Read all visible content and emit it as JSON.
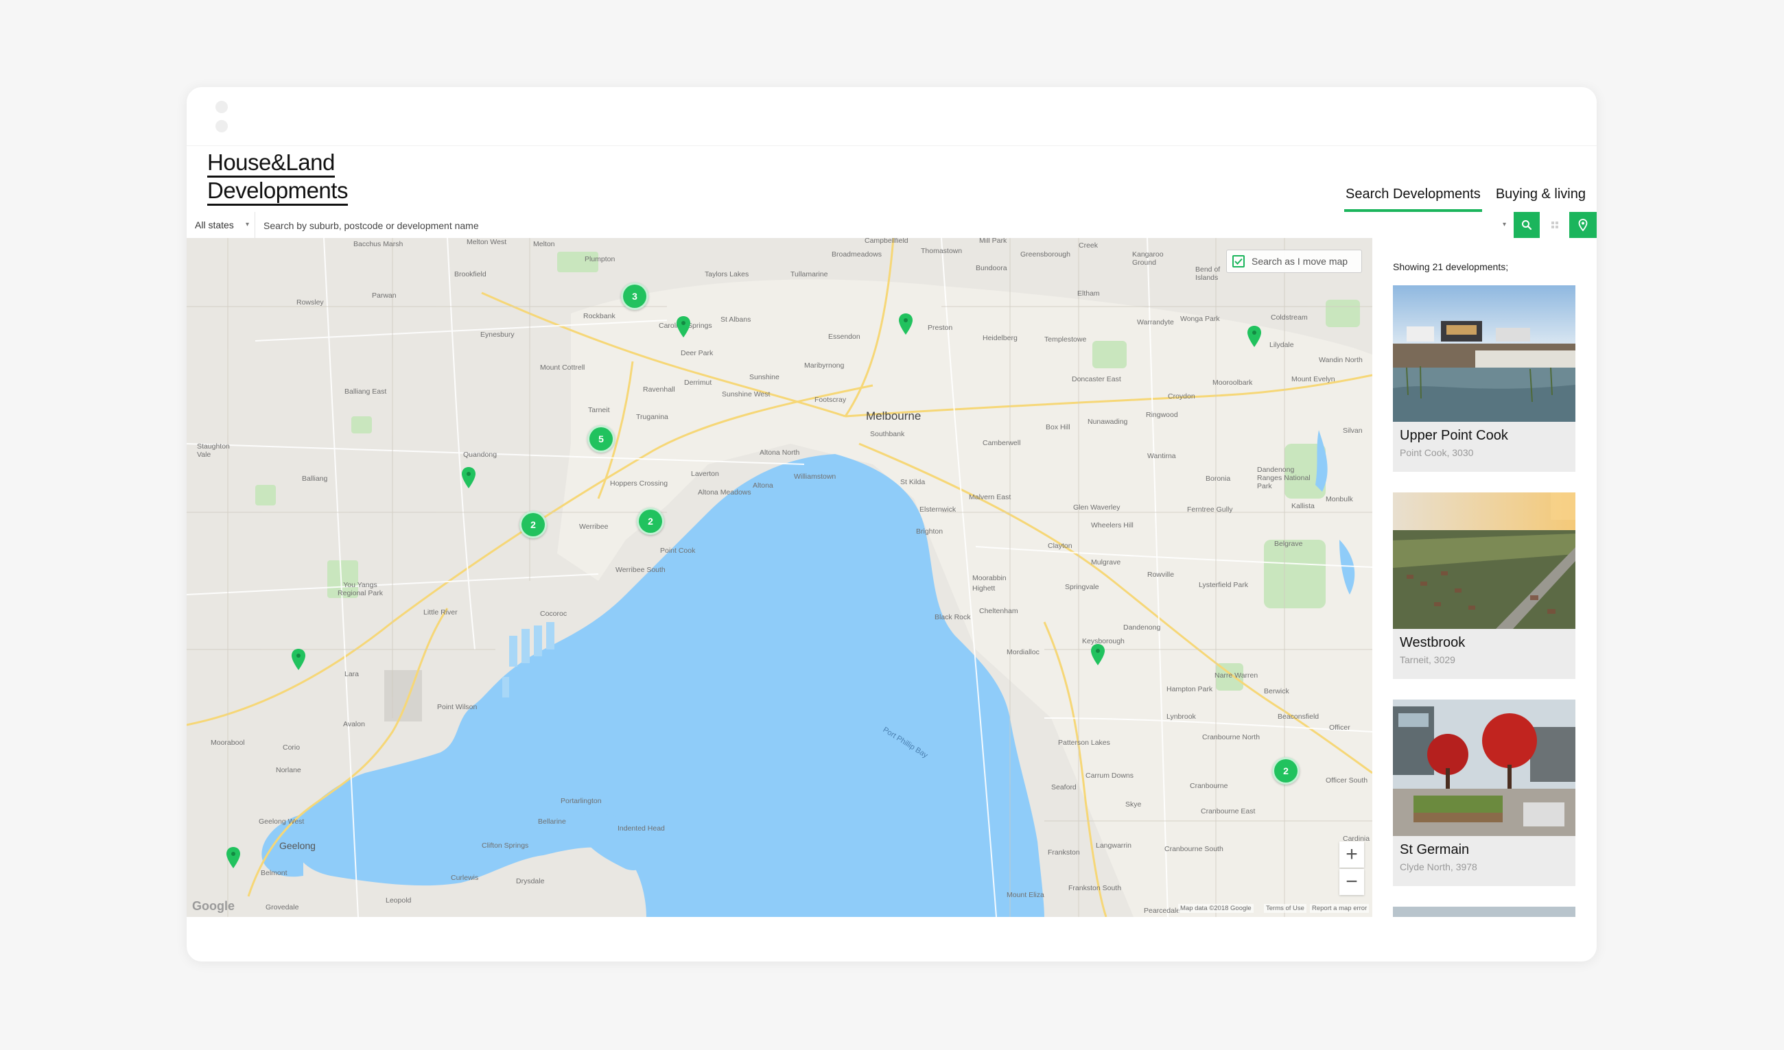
{
  "brand": {
    "line1": "House&Land",
    "line2": "Developments"
  },
  "nav": {
    "tabs": [
      {
        "label": "Search Developments",
        "active": true
      },
      {
        "label": "Buying & living",
        "active": false
      }
    ]
  },
  "search": {
    "state": "All states",
    "placeholder": "Search by suburb, postcode or development name"
  },
  "map": {
    "search_as_move_label": "Search as I move map",
    "search_as_move_checked": true,
    "zoom_in": "+",
    "zoom_out": "−",
    "google": "Google",
    "attribution": [
      "Map data ©2018 Google",
      "Terms of Use",
      "Report a map error"
    ],
    "clusters": [
      "3",
      "5",
      "2",
      "2",
      "2"
    ],
    "labels": {
      "melbourne": "Melbourne",
      "southbank": "Southbank",
      "st_kilda": "St Kilda",
      "altona": "Altona",
      "altona_north": "Altona North",
      "williamstown": "Williamstown",
      "footscray": "Footscray",
      "sunshine": "Sunshine",
      "sunshine_west": "Sunshine West",
      "deer_park": "Deer Park",
      "st_albans": "St Albans",
      "caroline_springs": "Caroline Springs",
      "rockbank": "Rockbank",
      "plumpton": "Plumpton",
      "taylors_lakes": "Taylors Lakes",
      "tullamarine": "Tullamarine",
      "broadmeadows": "Broadmeadows",
      "thomastown": "Thomastown",
      "bundoora": "Bundoora",
      "greensborough": "Greensborough",
      "eltham": "Eltham",
      "preston": "Preston",
      "essendon": "Essendon",
      "heidelberg": "Heidelberg",
      "templestowe": "Templestowe",
      "doncaster_east": "Doncaster East",
      "warrandyte": "Warrandyte",
      "wonga_park": "Wonga Park",
      "coldstream": "Coldstream",
      "lilydale": "Lilydale",
      "mooroolbark": "Mooroolbark",
      "croydon": "Croydon",
      "ringwood": "Ringwood",
      "nunawading": "Nunawading",
      "box_hill": "Box Hill",
      "camberwell": "Camberwell",
      "malvern_east": "Malvern East",
      "glen_waverley": "Glen Waverley",
      "wheelers_hill": "Wheelers Hill",
      "clayton": "Clayton",
      "brighton": "Brighton",
      "elsternwick": "Elsternwick",
      "moorabbin": "Moorabbin",
      "highett": "Highett",
      "cheltenham": "Cheltenham",
      "black_rock": "Black Rock",
      "mordialloc": "Mordialloc",
      "keysborough": "Keysborough",
      "springvale": "Springvale",
      "mulgrave": "Mulgrave",
      "rowville": "Rowville",
      "dandenong": "Dandenong",
      "lysterfield_park": "Lysterfield Park",
      "ferntree_gully": "Ferntree Gully",
      "boronia": "Boronia",
      "wantirna": "Wantirna",
      "belgrave": "Belgrave",
      "hampton_park": "Hampton Park",
      "narre_warren": "Narre Warren",
      "berwick": "Berwick",
      "lynbrook": "Lynbrook",
      "cranbourne_north": "Cranbourne North",
      "cranbourne": "Cranbourne",
      "cranbourne_east": "Cranbourne East",
      "cranbourne_south": "Cranbourne South",
      "carrum_downs": "Carrum Downs",
      "patterson_lakes": "Patterson Lakes",
      "seaford": "Seaford",
      "frankston": "Frankston",
      "frankston_south": "Frankston South",
      "langwarrin": "Langwarrin",
      "skye": "Skye",
      "mount_eliza": "Mount Eliza",
      "laverton": "Laverton",
      "altona_meadows": "Altona Meadows",
      "point_cook": "Point Cook",
      "hoppers_crossing": "Hoppers Crossing",
      "werribee": "Werribee",
      "werribee_south": "Werribee South",
      "tarneit": "Tarneit",
      "truganina": "Truganina",
      "ravenhall": "Ravenhall",
      "mount_cottrell": "Mount Cottrell",
      "eynesbury": "Eynesbury",
      "parwan": "Parwan",
      "rowsley": "Rowsley",
      "bacchus_marsh": "Bacchus Marsh",
      "melton_west": "Melton West",
      "melton": "Melton",
      "brookfield": "Brookfield",
      "balliang_east": "Balliang East",
      "balliang": "Balliang",
      "staughton_vale": "Staughton Vale",
      "quandong": "Quandong",
      "you_yangs": "You Yangs Regional Park",
      "little_river": "Little River",
      "cocoroc": "Cocoroc",
      "lara": "Lara",
      "avalon": "Avalon",
      "point_wilson": "Point Wilson",
      "moorabool": "Moorabool",
      "corio": "Corio",
      "norlane": "Norlane",
      "geelong_west": "Geelong West",
      "geelong": "Geelong",
      "belmont": "Belmont",
      "grovedale": "Grovedale",
      "leopold": "Leopold",
      "curlewis": "Curlewis",
      "drysdale": "Drysdale",
      "clifton_springs": "Clifton Springs",
      "portarlington": "Portarlington",
      "bellarine": "Bellarine",
      "indented_head": "Indented Head",
      "port_phillip_bay": "Port Phillip Bay",
      "kangaroo_ground": "Kangaroo Ground",
      "mount_evelyn": "Mount Evelyn",
      "wandin_north": "Wandin North",
      "silvan": "Silvan",
      "monbulk": "Monbulk",
      "kallista": "Kallista",
      "dandenong_ranges": "Dandenong Ranges National Park",
      "officer": "Officer",
      "officer_south": "Officer South",
      "beaconsfield": "Beaconsfield",
      "cardinia": "Cardinia",
      "pearcedale": "Pearcedale",
      "mill_park": "Mill Park",
      "creek": "Creek",
      "campbellfield": "Campbellfield",
      "maribyrnong": "Maribyrnong",
      "derrimut": "Derrimut",
      "bend_of_islands": "Bend of Islands"
    }
  },
  "sidebar": {
    "showing": "Showing 21 developments;",
    "cards": [
      {
        "name": "Upper Point Cook",
        "location": "Point Cook, 3030"
      },
      {
        "name": "Westbrook",
        "location": "Tarneit, 3029"
      },
      {
        "name": "St Germain",
        "location": "Clyde North, 3978"
      }
    ]
  },
  "colors": {
    "accent": "#1bb55c",
    "water": "#8fccf9",
    "land": "#e9e7e2",
    "park": "#c9e6be"
  },
  "icons": [
    "search-icon",
    "grid-icon",
    "map-pin-icon",
    "check-icon",
    "chevron-down-icon"
  ]
}
